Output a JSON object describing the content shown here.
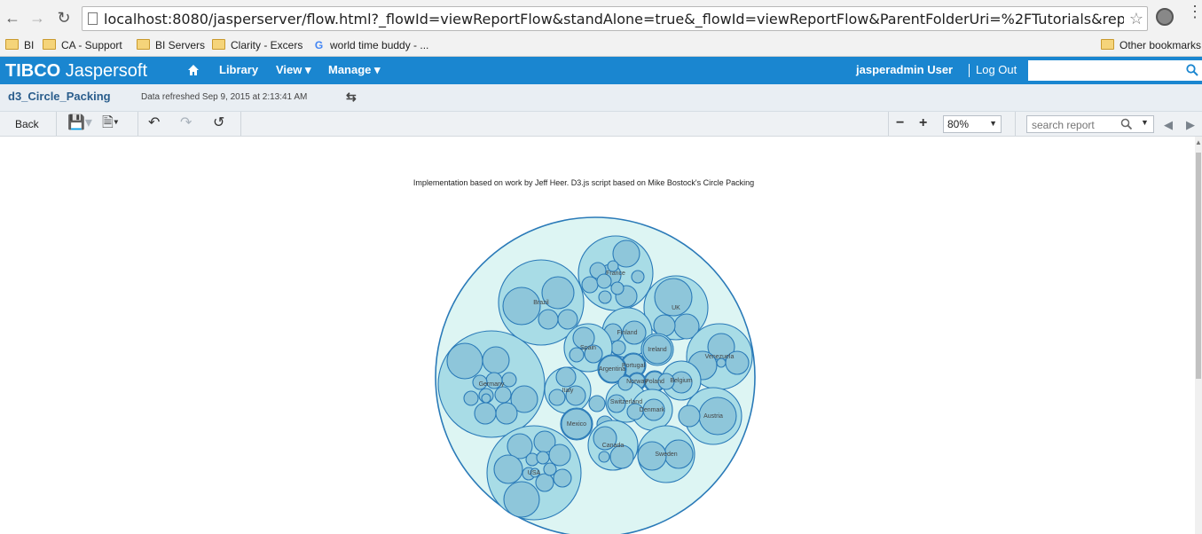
{
  "browser": {
    "url": "localhost:8080/jasperserver/flow.html?_flowId=viewReportFlow&standAlone=true&_flowId=viewReportFlow&ParentFolderUri=%2FTutorials&reportUnit=%2FTutori",
    "bookmarks": [
      "BI",
      "CA - Support",
      "BI Servers",
      "Clarity - Excers",
      "world time buddy - ..."
    ],
    "other_bookmarks": "Other bookmarks"
  },
  "header": {
    "logo_brand": "TIBCO",
    "logo_product": "Jaspersoft",
    "nav": {
      "library": "Library",
      "view": "View ▾",
      "manage": "Manage ▾"
    },
    "user": "jasperadmin User",
    "logout": "Log Out"
  },
  "report": {
    "title": "d3_Circle_Packing",
    "refreshed": "Data refreshed Sep 9, 2015 at 2:13:41 AM"
  },
  "toolbar": {
    "back": "Back",
    "zoom": "80%",
    "search_placeholder": "search report"
  },
  "viz": {
    "caption": "Implementation based on work by Jeff Heer. D3.js script based on Mike Bostock's Circle Packing",
    "colors": {
      "root_fill": "#ddf5f3",
      "group_fill": "#a8dce6",
      "leaf_fill": "#8ec6da",
      "stroke": "#2a7ab8"
    },
    "countries": [
      "France",
      "Brazil",
      "UK",
      "Finland",
      "Spain",
      "Ireland",
      "Venezuela",
      "Portugal",
      "Argentina",
      "Germany",
      "Norway",
      "Poland",
      "Belgium",
      "Italy",
      "Switzerland",
      "Denmark",
      "Austria",
      "Mexico",
      "Canada",
      "Sweden",
      "USA"
    ]
  }
}
